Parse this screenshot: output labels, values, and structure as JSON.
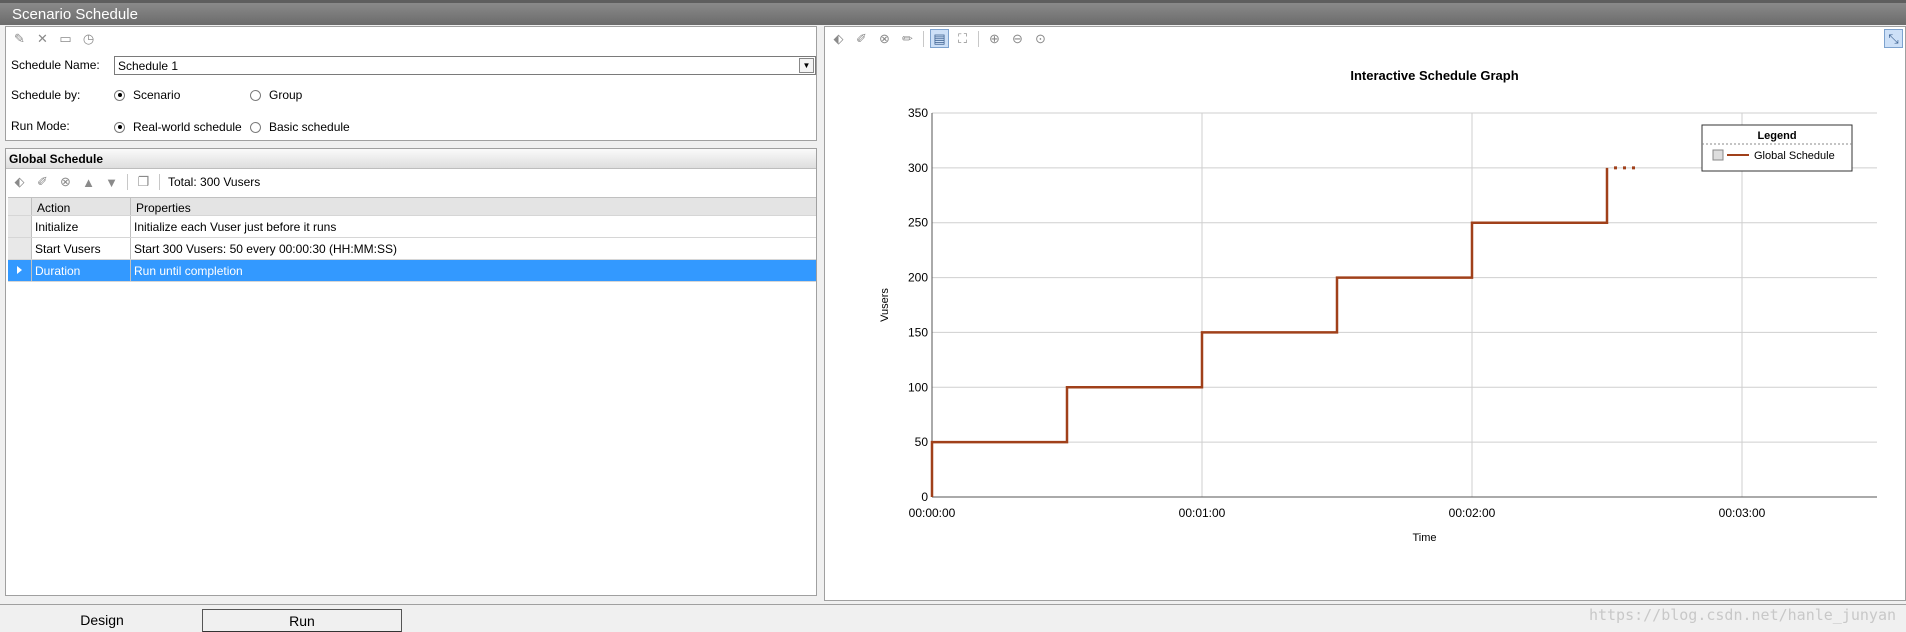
{
  "window": {
    "title": "Scenario Schedule"
  },
  "schedule_form": {
    "toolbar_icons": [
      "new-schedule-icon",
      "delete-icon",
      "rename-icon",
      "schedule-clock-icon"
    ],
    "schedule_name_label": "Schedule Name:",
    "schedule_name_value": "Schedule 1",
    "schedule_by_label": "Schedule by:",
    "schedule_by_options": [
      "Scenario",
      "Group"
    ],
    "schedule_by_selected": "Scenario",
    "run_mode_label": "Run Mode:",
    "run_mode_options": [
      "Real-world schedule",
      "Basic schedule"
    ],
    "run_mode_selected": "Real-world schedule"
  },
  "global_schedule": {
    "title": "Global Schedule",
    "total": "Total: 300 Vusers",
    "columns": [
      "Action",
      "Properties"
    ],
    "rows": [
      {
        "action": "Initialize",
        "properties": "Initialize each Vuser just before it runs"
      },
      {
        "action": "Start  Vusers",
        "properties": "Start 300 Vusers: 50 every 00:00:30 (HH:MM:SS)"
      },
      {
        "action": "Duration",
        "properties": "Run until completion"
      }
    ],
    "selected_row": 2
  },
  "graph": {
    "toolbar_icons": [
      "add-action-icon",
      "edit-action-icon",
      "delete-action-icon",
      "pencil-icon",
      "edit-mode-icon",
      "fit-icon",
      "zoom-in-icon",
      "zoom-out-icon",
      "zoom-reset-icon"
    ],
    "accent_color": "#a0401a"
  },
  "chart_data": {
    "type": "line",
    "title": "Interactive Schedule Graph",
    "xlabel": "Time",
    "ylabel": "Vusers",
    "x_ticks": [
      "00:00:00",
      "00:01:00",
      "00:02:00",
      "00:03:00"
    ],
    "x_range_seconds": [
      0,
      210
    ],
    "ylim": [
      0,
      350
    ],
    "y_ticks": [
      0,
      50,
      100,
      150,
      200,
      250,
      300,
      350
    ],
    "grid": true,
    "legend_title": "Legend",
    "legend_position": "top-right",
    "series": [
      {
        "name": "Global Schedule",
        "color": "#a0401a",
        "step_points": [
          [
            0,
            0
          ],
          [
            0,
            50
          ],
          [
            30,
            50
          ],
          [
            30,
            100
          ],
          [
            60,
            100
          ],
          [
            60,
            150
          ],
          [
            90,
            150
          ],
          [
            90,
            200
          ],
          [
            120,
            200
          ],
          [
            120,
            250
          ],
          [
            150,
            250
          ],
          [
            150,
            300
          ]
        ],
        "continuation_dots_at": 300
      }
    ]
  },
  "tabs": [
    "Design",
    "Run"
  ],
  "watermark": "https://blog.csdn.net/hanle_junyan"
}
